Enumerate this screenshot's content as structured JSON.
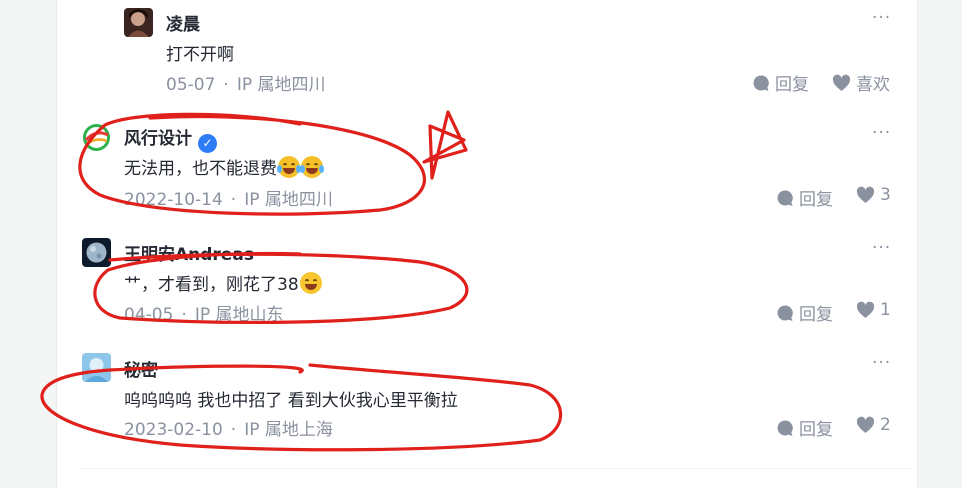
{
  "comments": [
    {
      "user": "凌晨",
      "text": "打不开啊",
      "date": "05-07",
      "location": "IP 属地四川",
      "reply_label": "回复",
      "like_label": "喜欢",
      "verified": false
    },
    {
      "user": "风行设计",
      "text": "无法用，也不能退费",
      "date": "2022-10-14",
      "location": "IP 属地四川",
      "reply_label": "回复",
      "like_label": "3",
      "verified": true,
      "emojis": [
        "cry-laugh",
        "cry-laugh"
      ]
    },
    {
      "user": "王明安Andreas",
      "text": "艹，才看到，刚花了38",
      "date": "04-05",
      "location": "IP 属地山东",
      "reply_label": "回复",
      "like_label": "1",
      "verified": false,
      "emojis": [
        "grin"
      ]
    },
    {
      "user": "秘密",
      "text": "呜呜呜呜 我也中招了 看到大伙我心里平衡拉",
      "date": "2023-02-10",
      "location": "IP 属地上海",
      "reply_label": "回复",
      "like_label": "2",
      "verified": false
    }
  ],
  "more_label": "···",
  "meta_separator": "·",
  "colors": {
    "text": "#252933",
    "muted": "#8a919f",
    "verified_badge": "#2f7df6",
    "markup_red": "#e0201b"
  },
  "icons": {
    "reply": "comment-bubble-icon",
    "like": "heart-icon",
    "more": "more-dots-icon",
    "verified": "verified-check-icon"
  }
}
